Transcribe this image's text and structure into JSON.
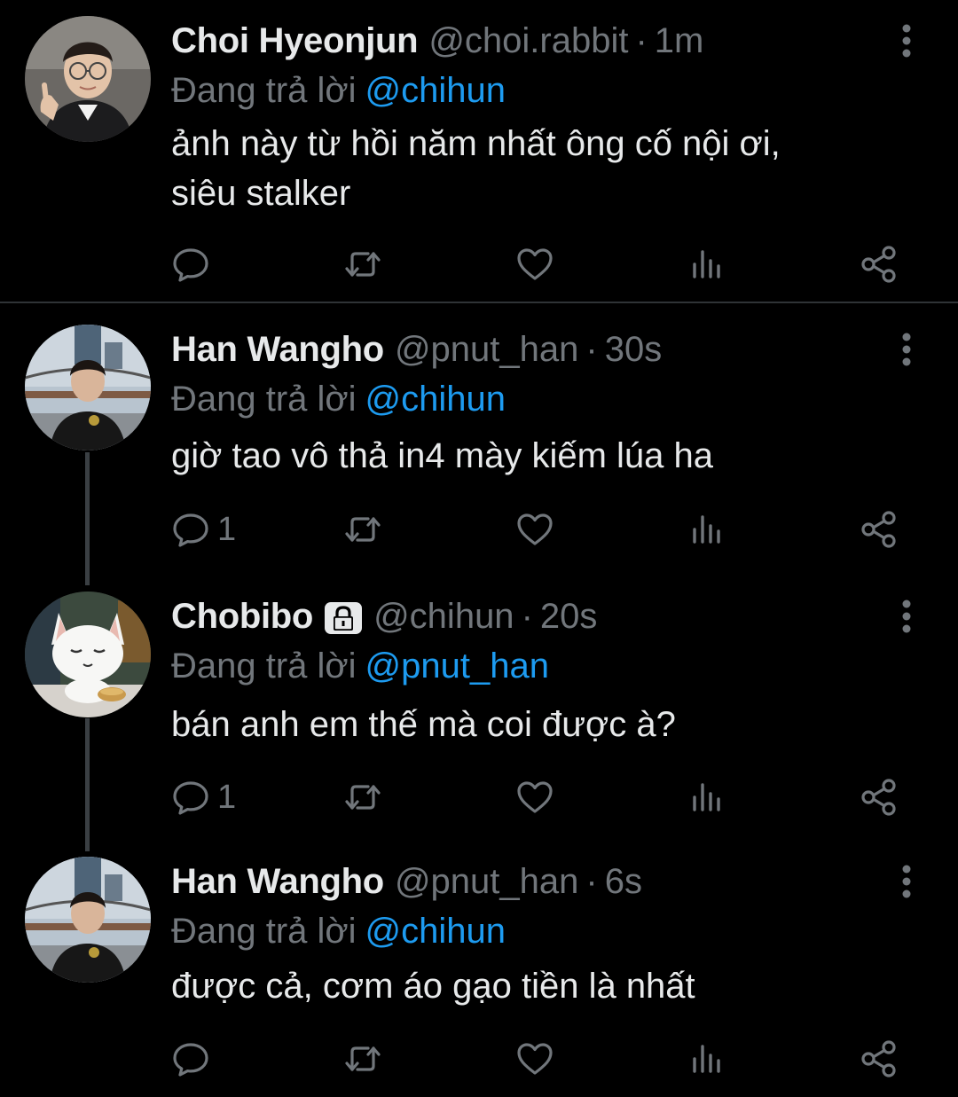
{
  "colors": {
    "background": "#000000",
    "text_primary": "#e7e9ea",
    "text_secondary": "#71767b",
    "accent": "#1d9bf0",
    "divider": "#2f3336"
  },
  "reply_prefix": "Đang trả lời",
  "tweets": [
    {
      "name": "Choi Hyeonjun",
      "handle": "@choi.rabbit",
      "separator": "·",
      "time": "1m",
      "reply_to": "@chihun",
      "text_lines": [
        "ảnh này từ hồi năm nhất ông cố nội ơi,",
        "siêu stalker"
      ],
      "reply_count": "",
      "locked": false,
      "avatar_icon": "person-avatar-icon"
    },
    {
      "name": "Han Wangho",
      "handle": "@pnut_han",
      "separator": "·",
      "time": "30s",
      "reply_to": "@chihun",
      "text_lines": [
        "giờ tao vô thả in4 mày kiếm lúa ha"
      ],
      "reply_count": "1",
      "locked": false,
      "avatar_icon": "person-avatar-icon"
    },
    {
      "name": "Chobibo",
      "handle": "@chihun",
      "separator": "·",
      "time": "20s",
      "reply_to": "@pnut_han",
      "text_lines": [
        "bán anh em thế mà coi được à?"
      ],
      "reply_count": "1",
      "locked": true,
      "avatar_icon": "cat-avatar-icon"
    },
    {
      "name": "Han Wangho",
      "handle": "@pnut_han",
      "separator": "·",
      "time": "6s",
      "reply_to": "@chihun",
      "text_lines": [
        "được cả, cơm áo gạo tiền là nhất"
      ],
      "reply_count": "",
      "locked": false,
      "avatar_icon": "person-avatar-icon"
    }
  ],
  "action_icons": [
    "reply-icon",
    "retweet-icon",
    "like-icon",
    "views-icon",
    "share-icon"
  ]
}
